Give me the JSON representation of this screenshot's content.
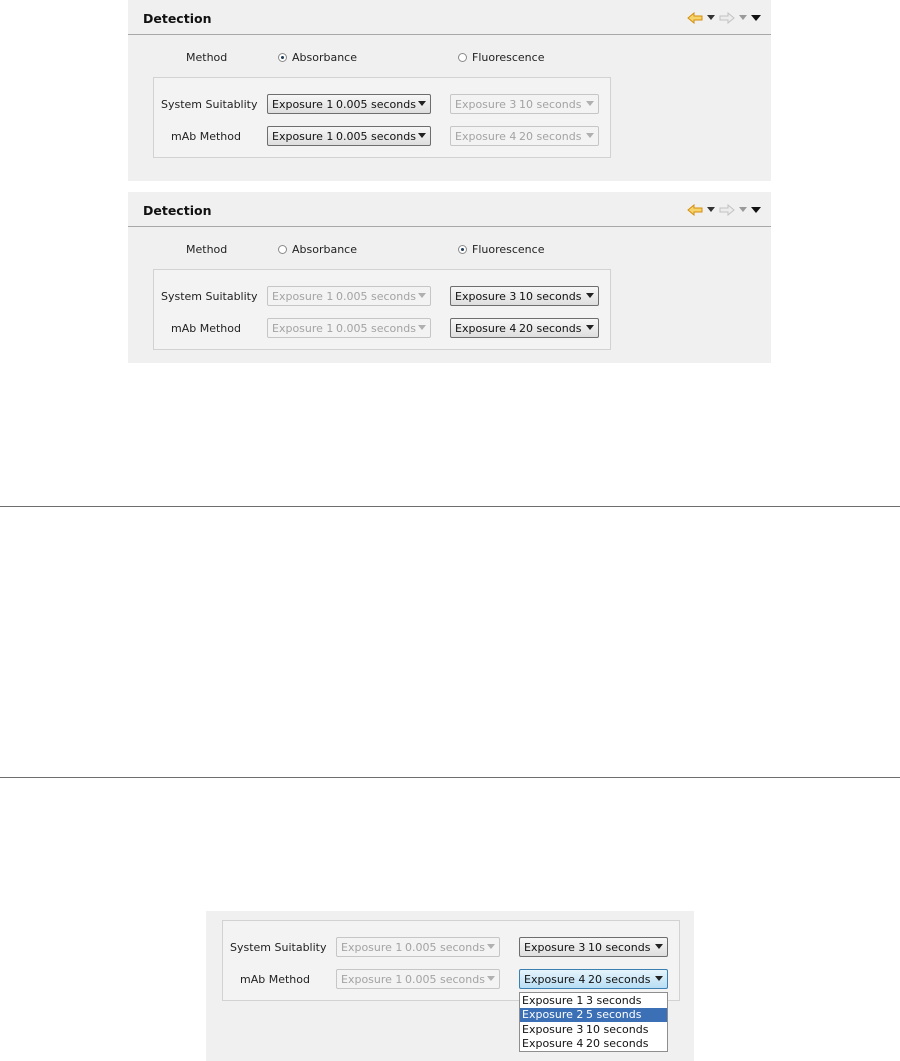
{
  "panels": [
    {
      "title": "Detection",
      "method_label": "Method",
      "method": "Absorbance",
      "radio_options": [
        "Absorbance",
        "Fluorescence"
      ],
      "rows": [
        {
          "label": "System Suitablity",
          "abs": {
            "name": "Exposure 1",
            "time": "0.005 seconds",
            "enabled": true
          },
          "flu": {
            "name": "Exposure 3",
            "time": "10 seconds",
            "enabled": false
          }
        },
        {
          "label": "mAb Method",
          "abs": {
            "name": "Exposure 1",
            "time": "0.005 seconds",
            "enabled": true
          },
          "flu": {
            "name": "Exposure 4",
            "time": "20 seconds",
            "enabled": false
          }
        }
      ]
    },
    {
      "title": "Detection",
      "method_label": "Method",
      "method": "Fluorescence",
      "radio_options": [
        "Absorbance",
        "Fluorescence"
      ],
      "rows": [
        {
          "label": "System Suitablity",
          "abs": {
            "name": "Exposure 1",
            "time": "0.005 seconds",
            "enabled": false
          },
          "flu": {
            "name": "Exposure 3",
            "time": "10 seconds",
            "enabled": true
          }
        },
        {
          "label": "mAb Method",
          "abs": {
            "name": "Exposure 1",
            "time": "0.005 seconds",
            "enabled": false
          },
          "flu": {
            "name": "Exposure 4",
            "time": "20 seconds",
            "enabled": true
          }
        }
      ]
    }
  ],
  "toolbar_icons": [
    "back-arrow-icon",
    "dropdown-icon",
    "forward-arrow-icon",
    "dropdown-icon",
    "view-menu-icon"
  ],
  "zoomed": {
    "rows": [
      {
        "label": "System Suitablity",
        "abs": {
          "name": "Exposure 1",
          "time": "0.005 seconds",
          "enabled": false
        },
        "flu": {
          "name": "Exposure 3",
          "time": "10 seconds",
          "enabled": true
        }
      },
      {
        "label": "mAb Method",
        "abs": {
          "name": "Exposure 1",
          "time": "0.005 seconds",
          "enabled": false
        },
        "flu": {
          "name": "Exposure 4",
          "time": "20 seconds",
          "enabled": true,
          "focused": true
        }
      }
    ],
    "dropdown_options": [
      {
        "name": "Exposure 1",
        "time": "3 seconds"
      },
      {
        "name": "Exposure 2",
        "time": "5 seconds",
        "highlighted": true
      },
      {
        "name": "Exposure 3",
        "time": "10 seconds"
      },
      {
        "name": "Exposure 4",
        "time": "20 seconds"
      }
    ]
  },
  "colors": {
    "panel_bg": "#f0f0f0",
    "highlight": "#3b6fb6",
    "back_arrow": "#e8a31c",
    "forward_arrow_disabled": "#c8c8c8"
  }
}
